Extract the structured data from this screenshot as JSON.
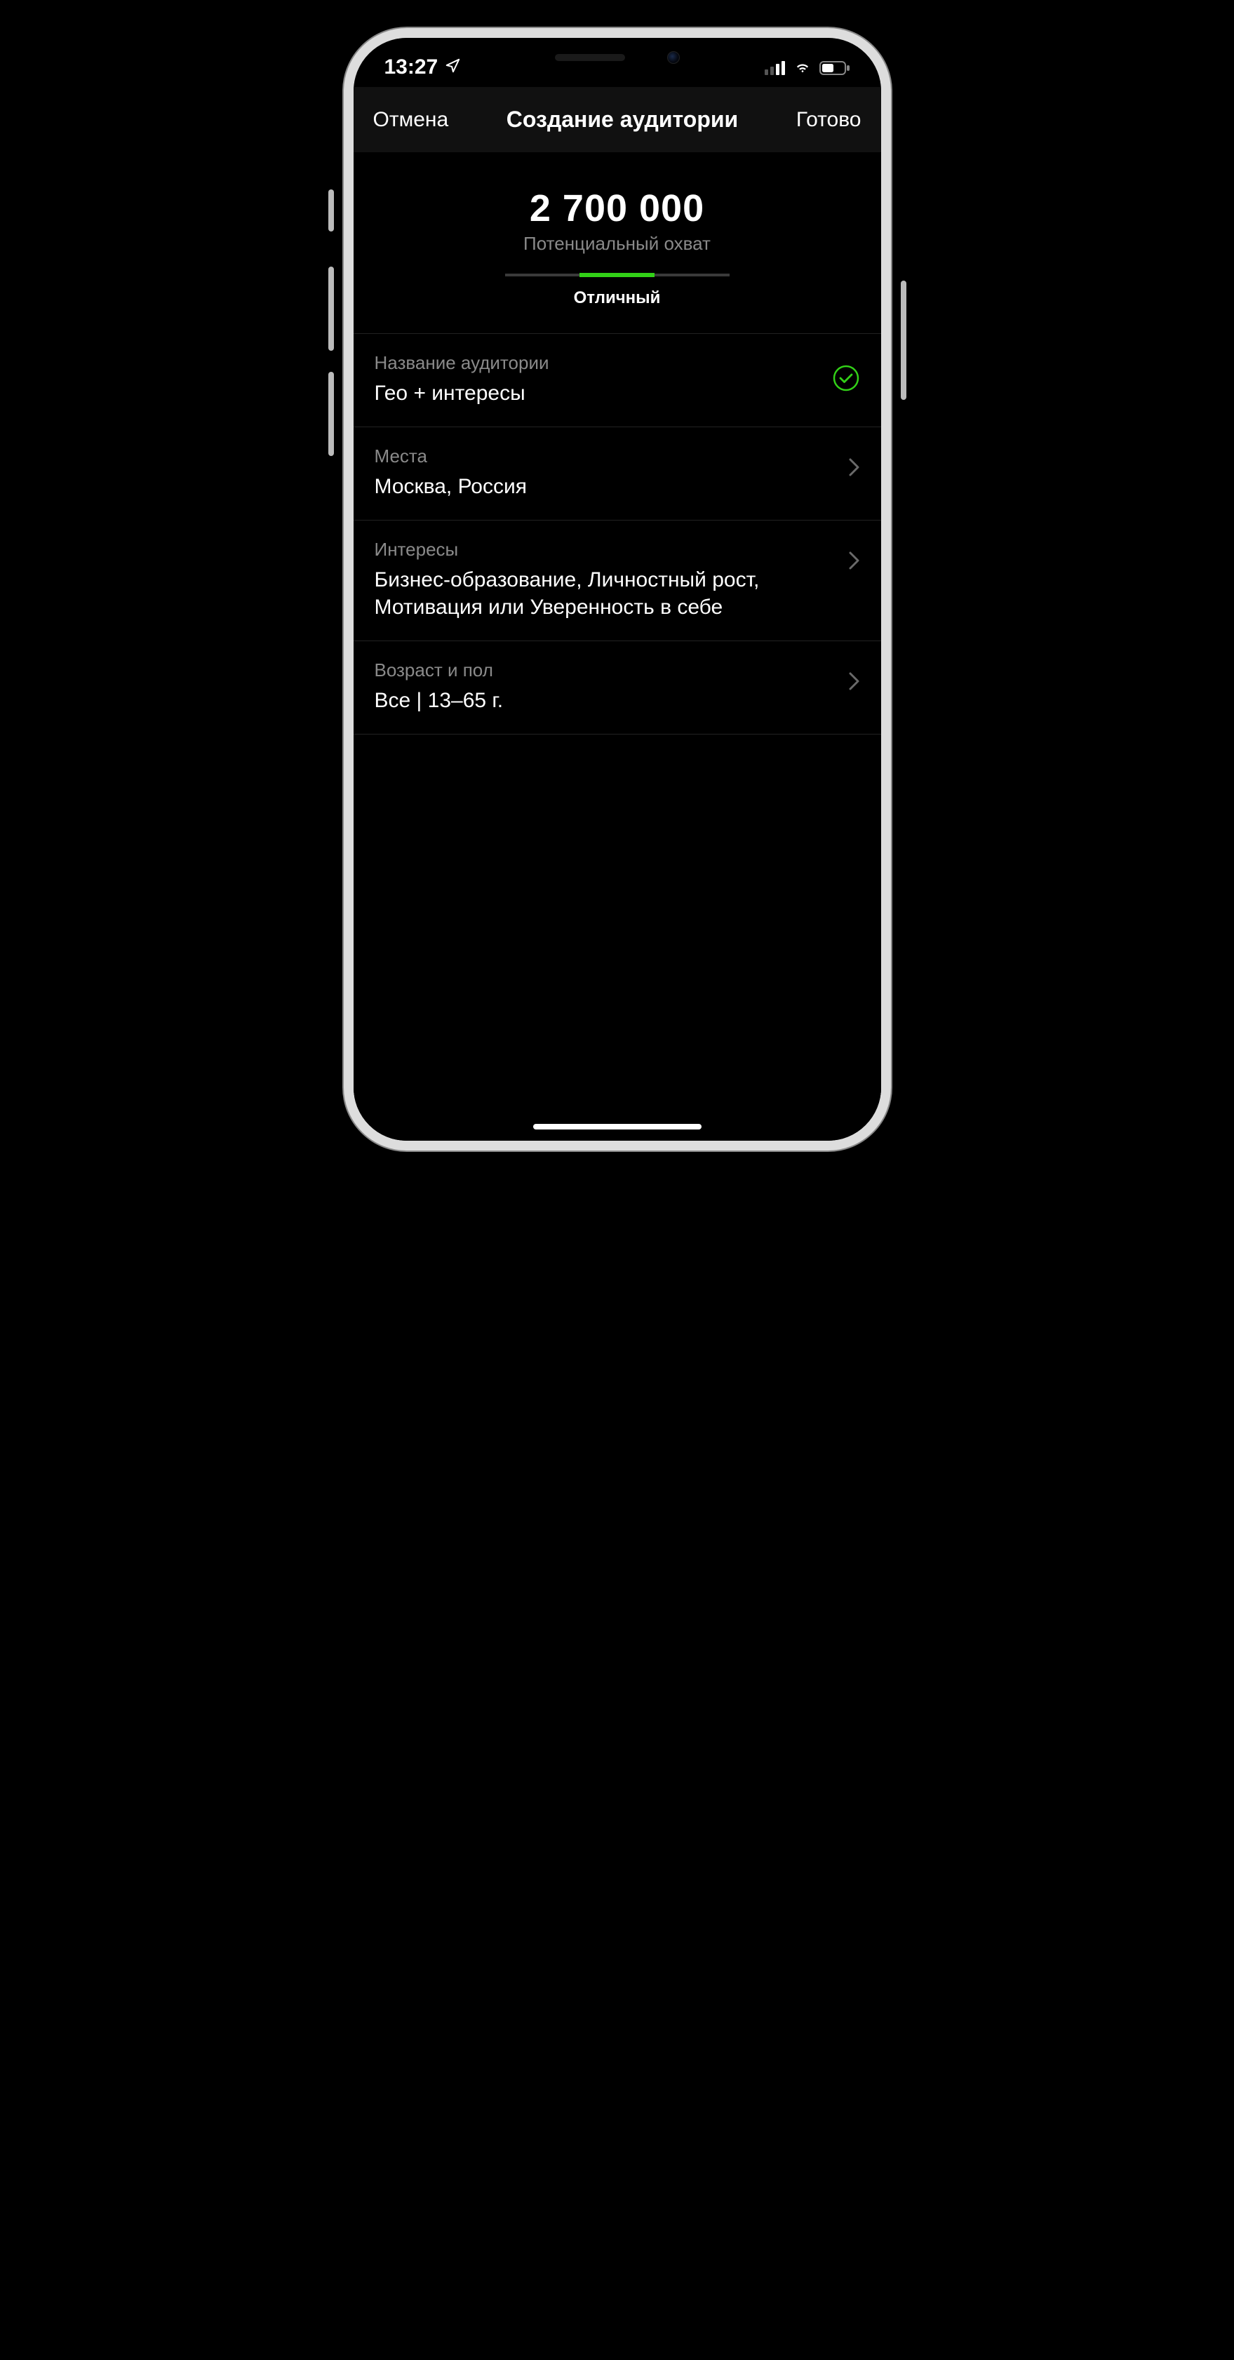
{
  "status": {
    "time": "13:27",
    "location_active": true
  },
  "nav": {
    "cancel": "Отмена",
    "title": "Создание аудитории",
    "done": "Готово"
  },
  "reach": {
    "number": "2 700 000",
    "label": "Потенциальный охват",
    "quality": "Отличный",
    "active_segment": 1,
    "segments": 3
  },
  "rows": {
    "name": {
      "label": "Название аудитории",
      "value": "Гео + интересы",
      "validated": true
    },
    "places": {
      "label": "Места",
      "value": "Москва, Россия"
    },
    "interests": {
      "label": "Интересы",
      "value": "Бизнес-образование, Личностный рост, Мотивация или Уверенность в себе"
    },
    "age_gender": {
      "label": "Возраст и пол",
      "value": "Все | 13–65 г."
    }
  },
  "colors": {
    "accent_green": "#32d117",
    "text_secondary": "#8a8a8a",
    "row_divider": "#222222"
  }
}
